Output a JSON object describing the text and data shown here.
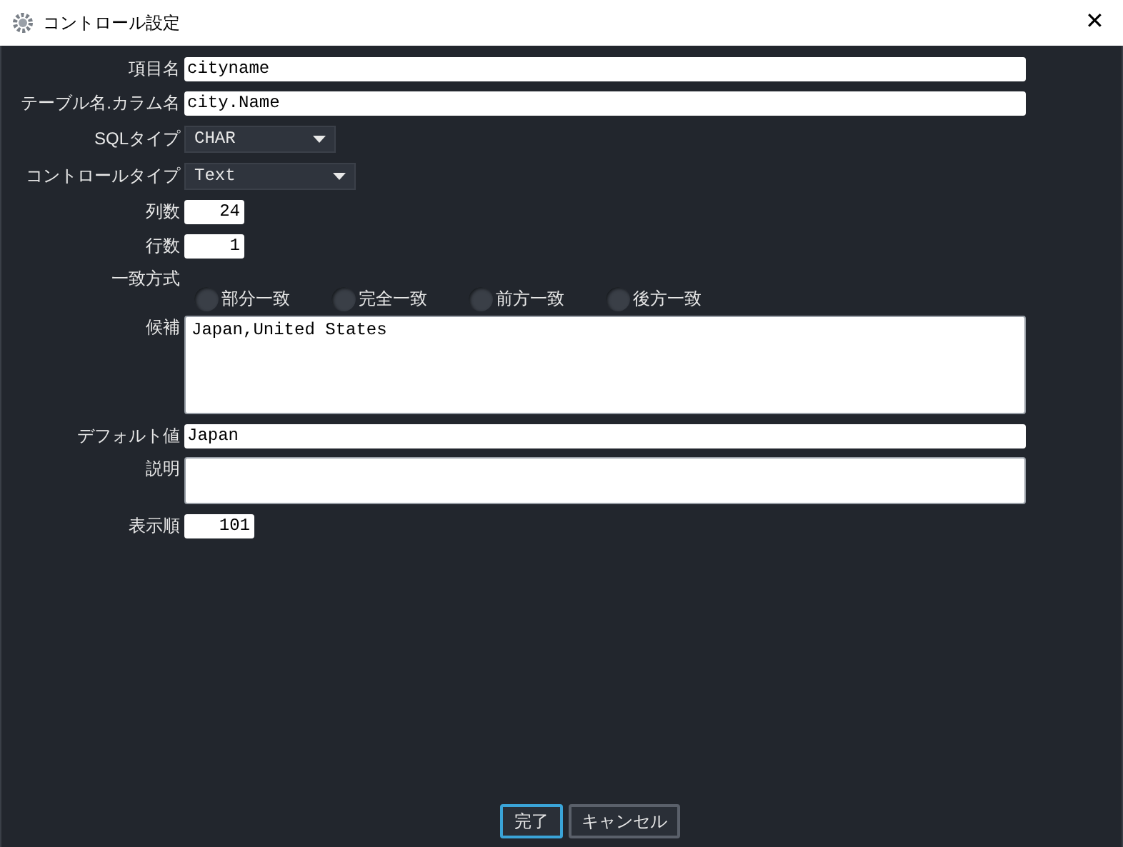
{
  "window": {
    "title": "コントロール設定",
    "close": "✕"
  },
  "fields": [
    {
      "kind": "text",
      "label": "項目名",
      "value": "cityname"
    },
    {
      "kind": "text",
      "label": "テーブル名.カラム名",
      "value": "city.Name"
    },
    {
      "kind": "select",
      "label": "SQLタイプ",
      "value": "CHAR"
    },
    {
      "kind": "select",
      "label": "コントロールタイプ",
      "value": "Text"
    },
    {
      "kind": "number",
      "label": "列数",
      "value": "24"
    },
    {
      "kind": "number",
      "label": "行数",
      "value": "1"
    },
    {
      "kind": "radio",
      "label": "一致方式",
      "options": [
        {
          "label": "部分一致",
          "selected": false
        },
        {
          "label": "完全一致",
          "selected": false
        },
        {
          "label": "前方一致",
          "selected": false
        },
        {
          "label": "後方一致",
          "selected": false
        }
      ]
    },
    {
      "kind": "area",
      "label": "候補",
      "value": "Japan,United States"
    },
    {
      "kind": "text",
      "label": "デフォルト値",
      "value": "Japan"
    },
    {
      "kind": "area",
      "label": "説明"
    },
    {
      "kind": "number",
      "label": "表示順",
      "value": "101"
    }
  ],
  "buttons": [
    {
      "label": "完了",
      "focused": true
    },
    {
      "label": "キャンセル",
      "focused": false
    }
  ]
}
